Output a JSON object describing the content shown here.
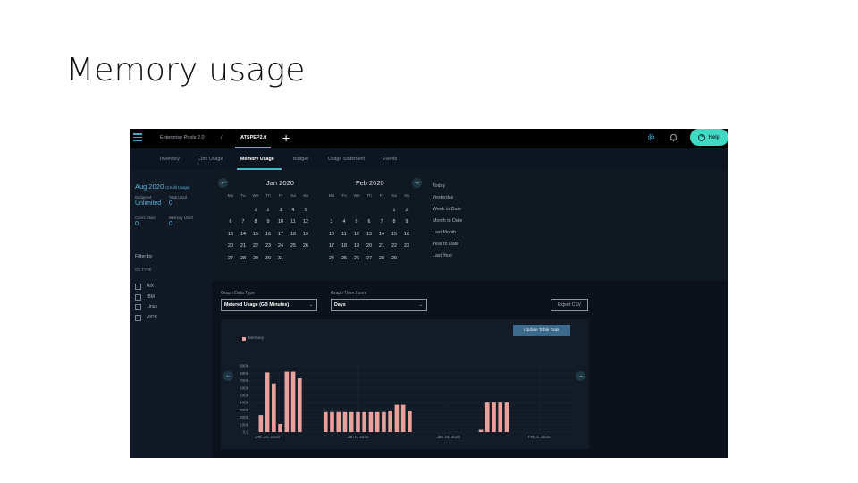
{
  "slide": {
    "title": "Memory usage"
  },
  "topbar": {
    "breadcrumb_home": "Enterprise Pools 2.0",
    "breadcrumb_sep": "/",
    "breadcrumb_current": "ATSPEP2.0",
    "add_icon": "+",
    "settings_icon": "gear-icon",
    "notifications_icon": "bell-icon",
    "help_label": "Help",
    "help_icon_glyph": "?",
    "accent_color": "#3fd9c4"
  },
  "tabs": [
    {
      "label": "Inventory",
      "active": false
    },
    {
      "label": "Core Usage",
      "active": false
    },
    {
      "label": "Memory Usage",
      "active": true
    },
    {
      "label": "Budget",
      "active": false
    },
    {
      "label": "Usage Statement",
      "active": false
    },
    {
      "label": "Events",
      "active": false
    }
  ],
  "summary": {
    "period": "Aug 2020",
    "period_note": "(Credit Usage)",
    "budgeted_label": "Budgeted",
    "budgeted_value": "Unlimited",
    "total_used_label": "Total Used",
    "total_used_value": "0",
    "cores_used_label": "Cores Used",
    "cores_used_value": "0",
    "memory_used_label": "Memory Used",
    "memory_used_value": "0"
  },
  "filter": {
    "title": "Filter by",
    "subtitle": "OS TYPE",
    "options": [
      {
        "label": "AIX",
        "checked": false
      },
      {
        "label": "IBM i",
        "checked": false
      },
      {
        "label": "Linux",
        "checked": false
      },
      {
        "label": "VIOS",
        "checked": false
      }
    ]
  },
  "calendar": {
    "prev_glyph": "←",
    "next_glyph": "→",
    "weekdays": [
      "Mo",
      "Tu",
      "We",
      "Th",
      "Fr",
      "Sa",
      "Su"
    ],
    "months": [
      {
        "title": "Jan 2020",
        "offset": 2,
        "days": 31
      },
      {
        "title": "Feb 2020",
        "offset": 5,
        "days": 29
      }
    ],
    "presets": [
      "Today",
      "Yesterday",
      "Week to Date",
      "Month to Date",
      "Last Month",
      "Year to Date",
      "Last Year"
    ]
  },
  "controls": {
    "data_type_label": "Graph Data Type",
    "data_type_value": "Metered Usage (GB Minutes)",
    "time_zoom_label": "Graph Time Zoom",
    "time_zoom_value": "Days",
    "chevron": "⌄",
    "export_label": "Export CSV",
    "update_label": "Update Table Data",
    "chart_prev_glyph": "←",
    "chart_next_glyph": "→"
  },
  "chart_data": {
    "type": "bar",
    "title": "",
    "legend": [
      "Memory"
    ],
    "legend_position": "top-left",
    "xlabel": "",
    "ylabel": "",
    "ylim": [
      0,
      900000
    ],
    "yticks": [
      0,
      100000,
      200000,
      300000,
      400000,
      500000,
      600000,
      700000,
      800000,
      900000
    ],
    "ytick_labels": [
      "0.0",
      "100k",
      "200k",
      "300k",
      "400k",
      "500k",
      "600k",
      "700k",
      "800k",
      "900k"
    ],
    "xtick_labels": [
      "Dec 22, 2019",
      "Jan 5, 2020",
      "Jan 19, 2020",
      "Feb 2, 2020"
    ],
    "xtick_positions": [
      2,
      16,
      30,
      44
    ],
    "x_count": 50,
    "grid": true,
    "bar_color": "#e8a09a",
    "series": [
      {
        "name": "Memory",
        "values": [
          0,
          230000,
          810000,
          660000,
          110000,
          820000,
          820000,
          730000,
          0,
          0,
          0,
          270000,
          270000,
          270000,
          270000,
          270000,
          270000,
          270000,
          270000,
          270000,
          270000,
          290000,
          370000,
          370000,
          290000,
          0,
          0,
          0,
          0,
          0,
          0,
          0,
          0,
          0,
          0,
          30000,
          400000,
          400000,
          400000,
          400000,
          0,
          0,
          0,
          0,
          0,
          0,
          0,
          0,
          0,
          0
        ]
      }
    ]
  }
}
